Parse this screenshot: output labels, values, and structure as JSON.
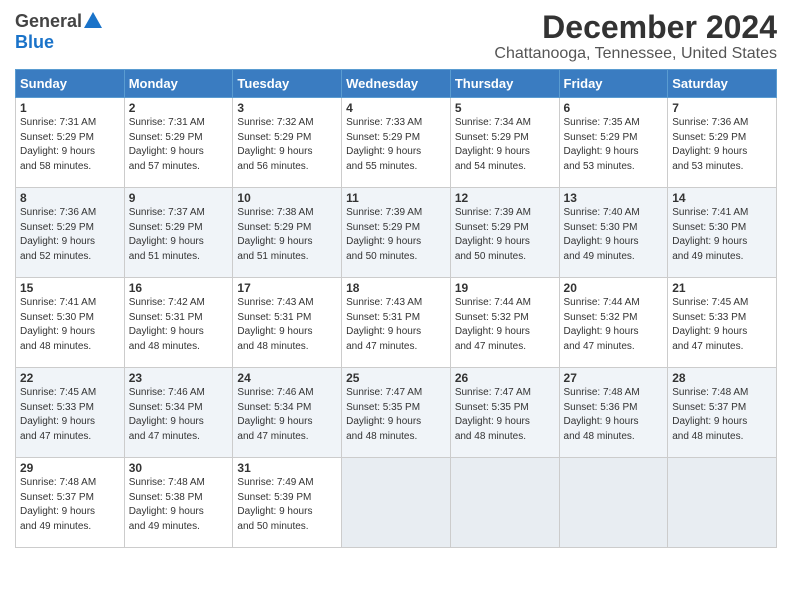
{
  "logo": {
    "general": "General",
    "blue": "Blue"
  },
  "title": "December 2024",
  "subtitle": "Chattanooga, Tennessee, United States",
  "weekdays": [
    "Sunday",
    "Monday",
    "Tuesday",
    "Wednesday",
    "Thursday",
    "Friday",
    "Saturday"
  ],
  "weeks": [
    [
      {
        "day": "1",
        "info": "Sunrise: 7:31 AM\nSunset: 5:29 PM\nDaylight: 9 hours\nand 58 minutes."
      },
      {
        "day": "2",
        "info": "Sunrise: 7:31 AM\nSunset: 5:29 PM\nDaylight: 9 hours\nand 57 minutes."
      },
      {
        "day": "3",
        "info": "Sunrise: 7:32 AM\nSunset: 5:29 PM\nDaylight: 9 hours\nand 56 minutes."
      },
      {
        "day": "4",
        "info": "Sunrise: 7:33 AM\nSunset: 5:29 PM\nDaylight: 9 hours\nand 55 minutes."
      },
      {
        "day": "5",
        "info": "Sunrise: 7:34 AM\nSunset: 5:29 PM\nDaylight: 9 hours\nand 54 minutes."
      },
      {
        "day": "6",
        "info": "Sunrise: 7:35 AM\nSunset: 5:29 PM\nDaylight: 9 hours\nand 53 minutes."
      },
      {
        "day": "7",
        "info": "Sunrise: 7:36 AM\nSunset: 5:29 PM\nDaylight: 9 hours\nand 53 minutes."
      }
    ],
    [
      {
        "day": "8",
        "info": "Sunrise: 7:36 AM\nSunset: 5:29 PM\nDaylight: 9 hours\nand 52 minutes."
      },
      {
        "day": "9",
        "info": "Sunrise: 7:37 AM\nSunset: 5:29 PM\nDaylight: 9 hours\nand 51 minutes."
      },
      {
        "day": "10",
        "info": "Sunrise: 7:38 AM\nSunset: 5:29 PM\nDaylight: 9 hours\nand 51 minutes."
      },
      {
        "day": "11",
        "info": "Sunrise: 7:39 AM\nSunset: 5:29 PM\nDaylight: 9 hours\nand 50 minutes."
      },
      {
        "day": "12",
        "info": "Sunrise: 7:39 AM\nSunset: 5:29 PM\nDaylight: 9 hours\nand 50 minutes."
      },
      {
        "day": "13",
        "info": "Sunrise: 7:40 AM\nSunset: 5:30 PM\nDaylight: 9 hours\nand 49 minutes."
      },
      {
        "day": "14",
        "info": "Sunrise: 7:41 AM\nSunset: 5:30 PM\nDaylight: 9 hours\nand 49 minutes."
      }
    ],
    [
      {
        "day": "15",
        "info": "Sunrise: 7:41 AM\nSunset: 5:30 PM\nDaylight: 9 hours\nand 48 minutes."
      },
      {
        "day": "16",
        "info": "Sunrise: 7:42 AM\nSunset: 5:31 PM\nDaylight: 9 hours\nand 48 minutes."
      },
      {
        "day": "17",
        "info": "Sunrise: 7:43 AM\nSunset: 5:31 PM\nDaylight: 9 hours\nand 48 minutes."
      },
      {
        "day": "18",
        "info": "Sunrise: 7:43 AM\nSunset: 5:31 PM\nDaylight: 9 hours\nand 47 minutes."
      },
      {
        "day": "19",
        "info": "Sunrise: 7:44 AM\nSunset: 5:32 PM\nDaylight: 9 hours\nand 47 minutes."
      },
      {
        "day": "20",
        "info": "Sunrise: 7:44 AM\nSunset: 5:32 PM\nDaylight: 9 hours\nand 47 minutes."
      },
      {
        "day": "21",
        "info": "Sunrise: 7:45 AM\nSunset: 5:33 PM\nDaylight: 9 hours\nand 47 minutes."
      }
    ],
    [
      {
        "day": "22",
        "info": "Sunrise: 7:45 AM\nSunset: 5:33 PM\nDaylight: 9 hours\nand 47 minutes."
      },
      {
        "day": "23",
        "info": "Sunrise: 7:46 AM\nSunset: 5:34 PM\nDaylight: 9 hours\nand 47 minutes."
      },
      {
        "day": "24",
        "info": "Sunrise: 7:46 AM\nSunset: 5:34 PM\nDaylight: 9 hours\nand 47 minutes."
      },
      {
        "day": "25",
        "info": "Sunrise: 7:47 AM\nSunset: 5:35 PM\nDaylight: 9 hours\nand 48 minutes."
      },
      {
        "day": "26",
        "info": "Sunrise: 7:47 AM\nSunset: 5:35 PM\nDaylight: 9 hours\nand 48 minutes."
      },
      {
        "day": "27",
        "info": "Sunrise: 7:48 AM\nSunset: 5:36 PM\nDaylight: 9 hours\nand 48 minutes."
      },
      {
        "day": "28",
        "info": "Sunrise: 7:48 AM\nSunset: 5:37 PM\nDaylight: 9 hours\nand 48 minutes."
      }
    ],
    [
      {
        "day": "29",
        "info": "Sunrise: 7:48 AM\nSunset: 5:37 PM\nDaylight: 9 hours\nand 49 minutes."
      },
      {
        "day": "30",
        "info": "Sunrise: 7:48 AM\nSunset: 5:38 PM\nDaylight: 9 hours\nand 49 minutes."
      },
      {
        "day": "31",
        "info": "Sunrise: 7:49 AM\nSunset: 5:39 PM\nDaylight: 9 hours\nand 50 minutes."
      },
      null,
      null,
      null,
      null
    ]
  ]
}
